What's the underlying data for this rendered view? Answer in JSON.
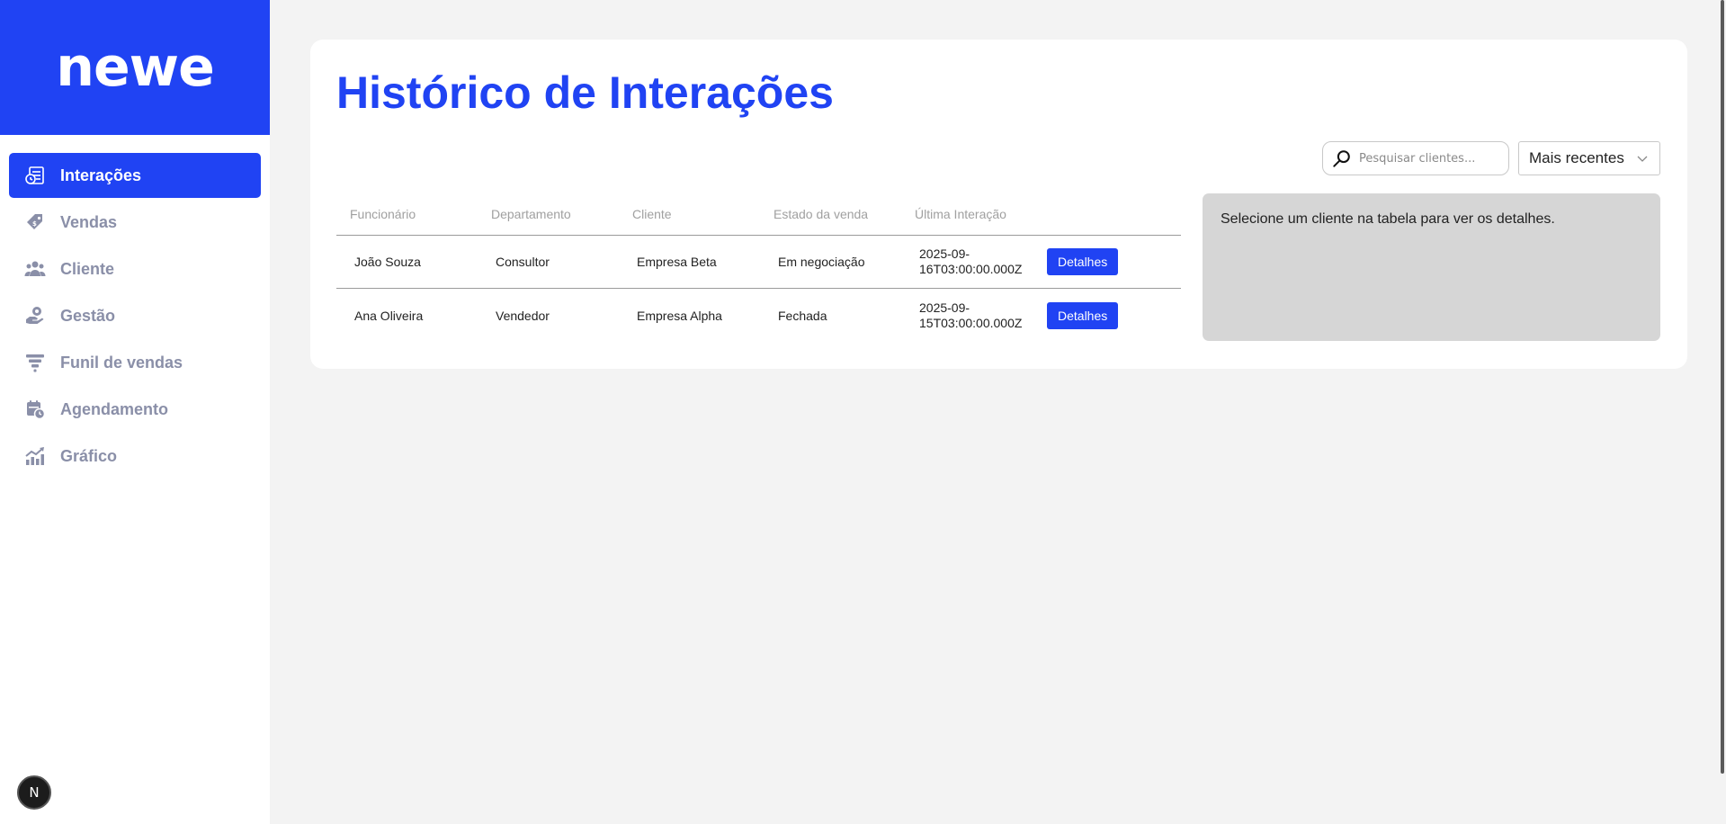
{
  "sidebar": {
    "logo": "newe",
    "items": [
      {
        "label": "Interações",
        "icon": "interactions-icon",
        "active": true
      },
      {
        "label": "Vendas",
        "icon": "sales-tag-icon",
        "active": false
      },
      {
        "label": "Cliente",
        "icon": "clients-group-icon",
        "active": false
      },
      {
        "label": "Gestão",
        "icon": "management-gear-hand-icon",
        "active": false
      },
      {
        "label": "Funil de vendas",
        "icon": "funnel-icon",
        "active": false
      },
      {
        "label": "Agendamento",
        "icon": "calendar-clock-icon",
        "active": false
      },
      {
        "label": "Gráfico",
        "icon": "chart-icon",
        "active": false
      }
    ]
  },
  "badge": {
    "letter": "N"
  },
  "main": {
    "title": "Histórico de Interações",
    "search": {
      "placeholder": "Pesquisar clientes..."
    },
    "sort": {
      "selected": "Mais recentes"
    },
    "table": {
      "headers": [
        "Funcionário",
        "Departamento",
        "Cliente",
        "Estado da venda",
        "Última Interação"
      ],
      "rows": [
        {
          "funcionario": "João Souza",
          "departamento": "Consultor",
          "cliente": "Empresa Beta",
          "estado": "Em negociação",
          "data_line1": "2025-09-",
          "data_line2": "16T03:00:00.000Z",
          "action": "Detalhes"
        },
        {
          "funcionario": "Ana Oliveira",
          "departamento": "Vendedor",
          "cliente": "Empresa Alpha",
          "estado": "Fechada",
          "data_line1": "2025-09-",
          "data_line2": "15T03:00:00.000Z",
          "action": "Detalhes"
        }
      ]
    },
    "details": {
      "message": "Selecione um cliente na tabela para ver os detalhes."
    }
  },
  "colors": {
    "brand": "#2043f3",
    "inactive_nav": "#8a8fa8",
    "details_bg": "#d6d6d6"
  }
}
